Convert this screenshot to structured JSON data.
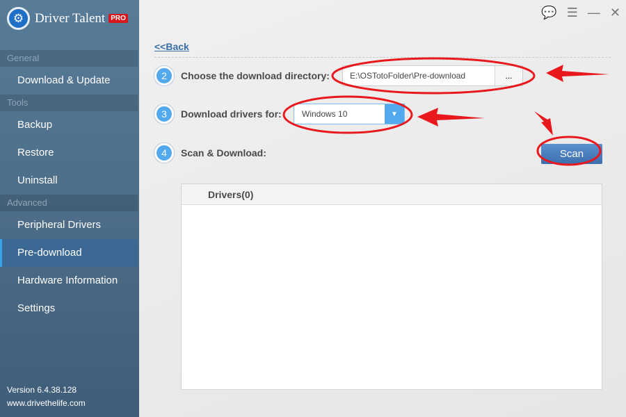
{
  "app": {
    "title": "Driver Talent",
    "badge": "PRO",
    "version": "Version 6.4.38.128",
    "website": "www.drivethelife.com"
  },
  "sidebar": {
    "sections": [
      "General",
      "Tools",
      "Advanced"
    ],
    "items": [
      "Download & Update",
      "Backup",
      "Restore",
      "Uninstall",
      "Peripheral Drivers",
      "Pre-download",
      "Hardware Information",
      "Settings"
    ],
    "active": "Pre-download"
  },
  "window": {
    "icons": [
      "chat-icon",
      "menu-icon",
      "minimize-icon",
      "close-icon"
    ]
  },
  "main": {
    "back": "<<Back",
    "steps": [
      {
        "num": "2",
        "label": "Choose the download directory:",
        "value": "E:\\OSTotoFolder\\Pre-download",
        "browse": "..."
      },
      {
        "num": "3",
        "label": "Download drivers for:",
        "value": "Windows 10"
      },
      {
        "num": "4",
        "label": "Scan & Download:",
        "button": "Scan"
      }
    ],
    "table_header": "Drivers(0)"
  },
  "colors": {
    "accent": "#52a9ee",
    "annotation": "#e8181c",
    "sidebar": "#587c98"
  }
}
